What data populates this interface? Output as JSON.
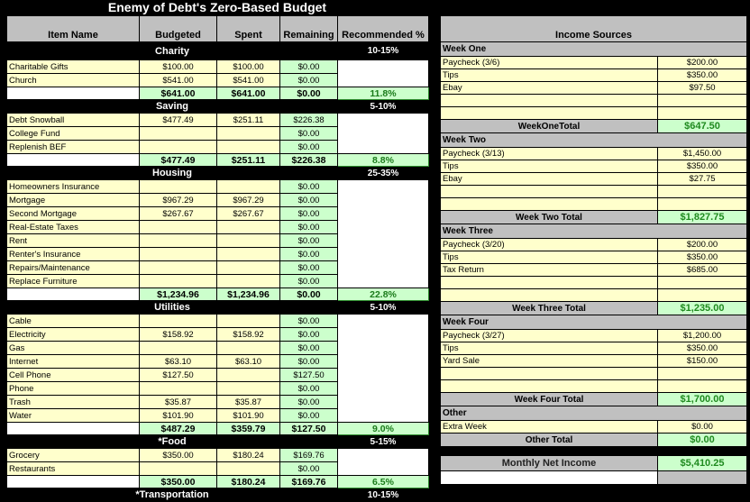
{
  "title": "Enemy of Debt's Zero-Based Budget",
  "budget": {
    "headers": [
      "Item Name",
      "Budgeted",
      "Spent",
      "Remaining",
      "Recommended %"
    ],
    "sections": [
      {
        "name": "Charity",
        "recommended": "10-15%",
        "items": [
          {
            "name": "Charitable Gifts",
            "budgeted": "$100.00",
            "spent": "$100.00",
            "remaining": "$0.00"
          },
          {
            "name": "Church",
            "budgeted": "$541.00",
            "spent": "$541.00",
            "remaining": "$0.00"
          }
        ],
        "total": {
          "budgeted": "$641.00",
          "spent": "$641.00",
          "remaining": "$0.00",
          "percent": "11.8%"
        }
      },
      {
        "name": "Saving",
        "recommended": "5-10%",
        "items": [
          {
            "name": "Debt Snowball",
            "budgeted": "$477.49",
            "spent": "$251.11",
            "remaining": "$226.38"
          },
          {
            "name": "College Fund",
            "budgeted": "",
            "spent": "",
            "remaining": "$0.00"
          },
          {
            "name": "Replenish BEF",
            "budgeted": "",
            "spent": "",
            "remaining": "$0.00"
          }
        ],
        "total": {
          "budgeted": "$477.49",
          "spent": "$251.11",
          "remaining": "$226.38",
          "percent": "8.8%"
        }
      },
      {
        "name": "Housing",
        "recommended": "25-35%",
        "items": [
          {
            "name": "Homeowners Insurance",
            "budgeted": "",
            "spent": "",
            "remaining": "$0.00"
          },
          {
            "name": "Mortgage",
            "budgeted": "$967.29",
            "spent": "$967.29",
            "remaining": "$0.00"
          },
          {
            "name": "Second Mortgage",
            "budgeted": "$267.67",
            "spent": "$267.67",
            "remaining": "$0.00"
          },
          {
            "name": "Real-Estate Taxes",
            "budgeted": "",
            "spent": "",
            "remaining": "$0.00"
          },
          {
            "name": "Rent",
            "budgeted": "",
            "spent": "",
            "remaining": "$0.00"
          },
          {
            "name": "Renter's Insurance",
            "budgeted": "",
            "spent": "",
            "remaining": "$0.00"
          },
          {
            "name": "Repairs/Maintenance",
            "budgeted": "",
            "spent": "",
            "remaining": "$0.00"
          },
          {
            "name": "Replace Furniture",
            "budgeted": "",
            "spent": "",
            "remaining": "$0.00"
          }
        ],
        "total": {
          "budgeted": "$1,234.96",
          "spent": "$1,234.96",
          "remaining": "$0.00",
          "percent": "22.8%"
        }
      },
      {
        "name": "Utilities",
        "recommended": "5-10%",
        "items": [
          {
            "name": "Cable",
            "budgeted": "",
            "spent": "",
            "remaining": "$0.00"
          },
          {
            "name": "Electricity",
            "budgeted": "$158.92",
            "spent": "$158.92",
            "remaining": "$0.00"
          },
          {
            "name": "Gas",
            "budgeted": "",
            "spent": "",
            "remaining": "$0.00"
          },
          {
            "name": "Internet",
            "budgeted": "$63.10",
            "spent": "$63.10",
            "remaining": "$0.00"
          },
          {
            "name": "Cell Phone",
            "budgeted": "$127.50",
            "spent": "",
            "remaining": "$127.50"
          },
          {
            "name": "Phone",
            "budgeted": "",
            "spent": "",
            "remaining": "$0.00"
          },
          {
            "name": "Trash",
            "budgeted": "$35.87",
            "spent": "$35.87",
            "remaining": "$0.00"
          },
          {
            "name": "Water",
            "budgeted": "$101.90",
            "spent": "$101.90",
            "remaining": "$0.00"
          }
        ],
        "total": {
          "budgeted": "$487.29",
          "spent": "$359.79",
          "remaining": "$127.50",
          "percent": "9.0%"
        }
      },
      {
        "name": "*Food",
        "recommended": "5-15%",
        "items": [
          {
            "name": "Grocery",
            "budgeted": "$350.00",
            "spent": "$180.24",
            "remaining": "$169.76"
          },
          {
            "name": "Restaurants",
            "budgeted": "",
            "spent": "",
            "remaining": "$0.00"
          }
        ],
        "total": {
          "budgeted": "$350.00",
          "spent": "$180.24",
          "remaining": "$169.76",
          "percent": "6.5%"
        }
      },
      {
        "name": "*Transportation",
        "recommended": "10-15%",
        "items": [],
        "total": null
      }
    ]
  },
  "income": {
    "header": "Income Sources",
    "weeks": [
      {
        "name": "Week One",
        "items": [
          {
            "name": "Paycheck (3/6)",
            "amount": "$200.00"
          },
          {
            "name": "Tips",
            "amount": "$350.00"
          },
          {
            "name": "Ebay",
            "amount": "$97.50"
          },
          {
            "name": "",
            "amount": ""
          },
          {
            "name": "",
            "amount": ""
          }
        ],
        "total_label": "WeekOneTotal",
        "total": "$647.50"
      },
      {
        "name": "Week Two",
        "items": [
          {
            "name": "Paycheck (3/13)",
            "amount": "$1,450.00"
          },
          {
            "name": "Tips",
            "amount": "$350.00"
          },
          {
            "name": "Ebay",
            "amount": "$27.75"
          },
          {
            "name": "",
            "amount": ""
          },
          {
            "name": "",
            "amount": ""
          }
        ],
        "total_label": "Week Two Total",
        "total": "$1,827.75"
      },
      {
        "name": "Week Three",
        "items": [
          {
            "name": "Paycheck (3/20)",
            "amount": "$200.00"
          },
          {
            "name": "Tips",
            "amount": "$350.00"
          },
          {
            "name": "Tax Return",
            "amount": "$685.00"
          },
          {
            "name": "",
            "amount": ""
          },
          {
            "name": "",
            "amount": ""
          }
        ],
        "total_label": "Week Three Total",
        "total": "$1,235.00"
      },
      {
        "name": "Week Four",
        "items": [
          {
            "name": "Paycheck (3/27)",
            "amount": "$1,200.00"
          },
          {
            "name": "Tips",
            "amount": "$350.00"
          },
          {
            "name": "Yard Sale",
            "amount": "$150.00"
          },
          {
            "name": "",
            "amount": ""
          },
          {
            "name": "",
            "amount": ""
          }
        ],
        "total_label": "Week Four Total",
        "total": "$1,700.00"
      },
      {
        "name": "Other",
        "items": [
          {
            "name": "Extra Week",
            "amount": "$0.00"
          }
        ],
        "total_label": "Other Total",
        "total": "$0.00"
      }
    ],
    "net_label": "Monthly Net Income",
    "net_total": "$5,410.25"
  }
}
